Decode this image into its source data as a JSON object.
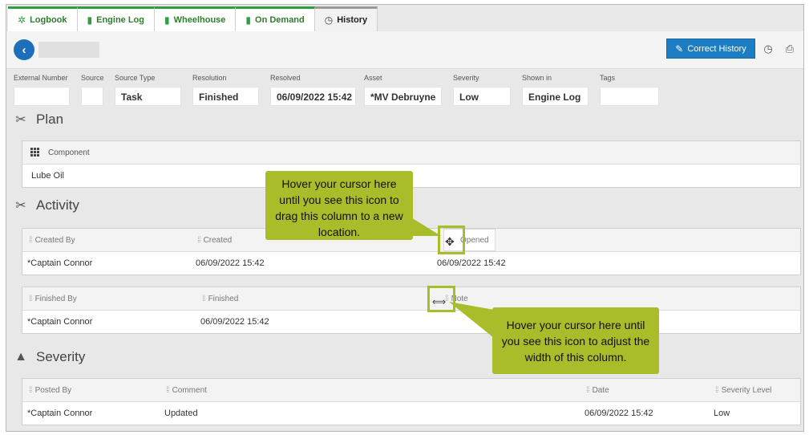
{
  "tabs": [
    {
      "label": "Logbook",
      "icon": "logbook-icon",
      "active": false
    },
    {
      "label": "Engine Log",
      "icon": "book-icon",
      "active": false
    },
    {
      "label": "Wheelhouse",
      "icon": "book-icon",
      "active": false
    },
    {
      "label": "On Demand",
      "icon": "book-icon",
      "active": false
    },
    {
      "label": "History",
      "icon": "history-icon",
      "active": true
    }
  ],
  "toolbar": {
    "correct_history_label": "Correct History"
  },
  "fields": [
    {
      "label": "External Number",
      "value": ""
    },
    {
      "label": "Source",
      "value": ""
    },
    {
      "label": "Source Type",
      "value": "Task"
    },
    {
      "label": "Resolution",
      "value": "Finished"
    },
    {
      "label": "Resolved",
      "value": "06/09/2022 15:42"
    },
    {
      "label": "Asset",
      "value": "*MV Debruyne"
    },
    {
      "label": "Severity",
      "value": "Low"
    },
    {
      "label": "Shown in",
      "value": "Engine Log"
    },
    {
      "label": "Tags",
      "value": ""
    }
  ],
  "plan": {
    "title": "Plan",
    "column": "Component",
    "row": "Lube Oil"
  },
  "activity": {
    "title": "Activity",
    "grid1": {
      "columns": [
        "Created By",
        "Created",
        "Opened"
      ],
      "row": [
        "*Captain Connor",
        "06/09/2022 15:42",
        "06/09/2022 15:42"
      ]
    },
    "grid2": {
      "columns": [
        "Finished By",
        "Finished",
        "Note"
      ],
      "row": [
        "*Captain Connor",
        "06/09/2022 15:42",
        ""
      ]
    }
  },
  "severity": {
    "title": "Severity",
    "columns": [
      "Posted By",
      "Comment",
      "Date",
      "Severity Level"
    ],
    "row": [
      "*Captain Connor",
      "Updated",
      "06/09/2022 15:42",
      "Low"
    ]
  },
  "callouts": {
    "drag": "Hover your cursor here until you see this icon to drag this column to a new location.",
    "resize": "Hover your cursor here until you see this icon to adjust the width of this column."
  },
  "colors": {
    "accent_green": "#2e9f3e",
    "primary_blue": "#1c7dc2",
    "callout_green": "#a9bc2a"
  }
}
